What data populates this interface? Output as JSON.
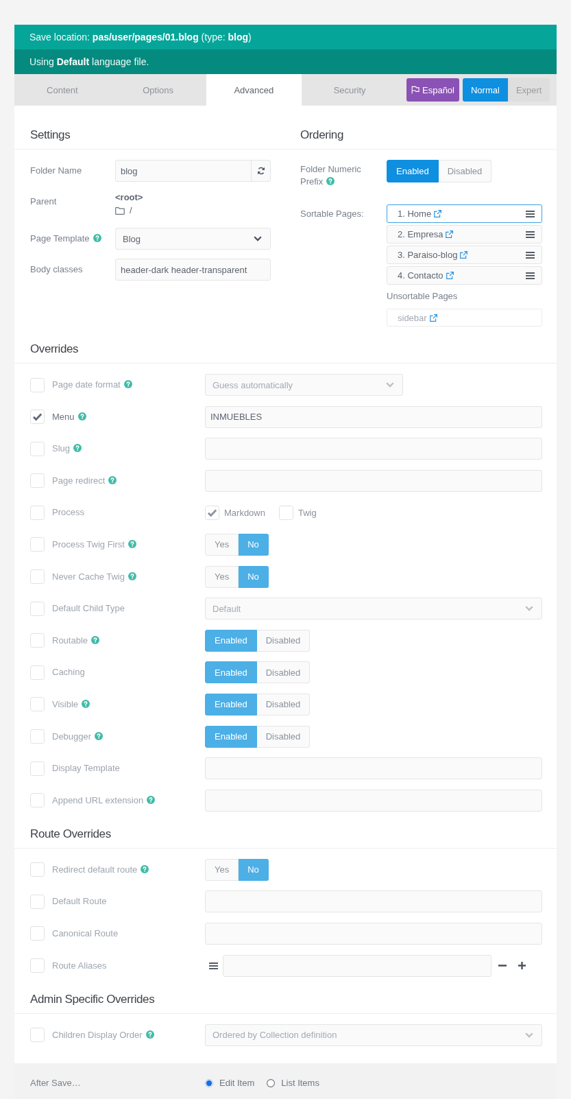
{
  "notices": [
    {
      "kind": "location",
      "text": "Save location: **pas/user/pages/01.blog** (type: **blog**)"
    },
    {
      "kind": "language",
      "text": "Using **Default** language file."
    }
  ],
  "tabs": [
    {
      "label": "Content",
      "selected": false
    },
    {
      "label": "Options",
      "selected": false
    },
    {
      "label": "Advanced",
      "selected": true
    },
    {
      "label": "Security",
      "selected": false
    }
  ],
  "language_button": {
    "label": "Español"
  },
  "mode_switch": [
    {
      "label": "Normal",
      "selected": true
    },
    {
      "label": "Expert",
      "selected": false
    }
  ],
  "settings": {
    "title": "Settings",
    "fields": [
      {
        "kind": "folder",
        "label": "Folder Name",
        "help": false,
        "value": "blog"
      },
      {
        "kind": "parent",
        "label": "Parent",
        "help": false,
        "value": "<root>",
        "path": "/"
      },
      {
        "kind": "select",
        "label": "Page Template",
        "help": true,
        "value": "Blog",
        "disabled": false
      },
      {
        "kind": "text",
        "label": "Body classes",
        "help": false,
        "value": "header-dark header-transparent"
      }
    ]
  },
  "ordering": {
    "title": "Ordering",
    "prefix": {
      "label": "Folder Numeric Prefix",
      "help": true,
      "options": [
        {
          "label": "Enabled",
          "selected": true
        },
        {
          "label": "Disabled",
          "selected": false
        }
      ]
    },
    "sortable": {
      "label": "Sortable Pages:",
      "pages": [
        {
          "label": "1. Home",
          "focused": true
        },
        {
          "label": "2. Empresa",
          "focused": false
        },
        {
          "label": "3. Paraiso-blog",
          "focused": false
        },
        {
          "label": "4. Contacto",
          "focused": false
        }
      ]
    },
    "unsortable": {
      "label": "Unsortable Pages",
      "pages": [
        {
          "label": "sidebar"
        }
      ]
    }
  },
  "sections": [
    {
      "title": "Overrides",
      "rows": [
        {
          "label": "Page date format",
          "help": true,
          "checked": false,
          "kind": "select",
          "value": "Guess automatically",
          "disabled": true
        },
        {
          "label": "Menu",
          "help": true,
          "checked": true,
          "kind": "text",
          "value": "INMUEBLES"
        },
        {
          "label": "Slug",
          "help": true,
          "checked": false,
          "kind": "text"
        },
        {
          "label": "Page redirect",
          "help": true,
          "checked": false,
          "kind": "text"
        },
        {
          "label": "Process",
          "help": false,
          "checked": false,
          "kind": "checkboxes",
          "options": [
            {
              "label": "Markdown",
              "checked": true
            },
            {
              "label": "Twig",
              "checked": false
            }
          ]
        },
        {
          "label": "Process Twig First",
          "help": true,
          "checked": false,
          "kind": "toggle",
          "options": [
            {
              "label": "Yes",
              "selected": false
            },
            {
              "label": "No",
              "selected": true
            }
          ]
        },
        {
          "label": "Never Cache Twig",
          "help": true,
          "checked": false,
          "kind": "toggle",
          "options": [
            {
              "label": "Yes",
              "selected": false
            },
            {
              "label": "No",
              "selected": true
            }
          ]
        },
        {
          "label": "Default Child Type",
          "help": false,
          "checked": false,
          "kind": "select",
          "value": "Default",
          "disabled": true
        },
        {
          "label": "Routable",
          "help": true,
          "checked": false,
          "kind": "toggle",
          "options": [
            {
              "label": "Enabled",
              "selected": true
            },
            {
              "label": "Disabled",
              "selected": false
            }
          ]
        },
        {
          "label": "Caching",
          "help": false,
          "checked": false,
          "kind": "toggle",
          "options": [
            {
              "label": "Enabled",
              "selected": true
            },
            {
              "label": "Disabled",
              "selected": false
            }
          ]
        },
        {
          "label": "Visible",
          "help": true,
          "checked": false,
          "kind": "toggle",
          "options": [
            {
              "label": "Enabled",
              "selected": true
            },
            {
              "label": "Disabled",
              "selected": false
            }
          ]
        },
        {
          "label": "Debugger",
          "help": true,
          "checked": false,
          "kind": "toggle",
          "options": [
            {
              "label": "Enabled",
              "selected": true
            },
            {
              "label": "Disabled",
              "selected": false
            }
          ]
        },
        {
          "label": "Display Template",
          "help": false,
          "checked": false,
          "kind": "text"
        },
        {
          "label": "Append URL extension",
          "help": true,
          "checked": false,
          "kind": "text"
        }
      ]
    },
    {
      "title": "Route Overrides",
      "rows": [
        {
          "label": "Redirect default route",
          "help": true,
          "checked": false,
          "kind": "toggle",
          "options": [
            {
              "label": "Yes",
              "selected": false
            },
            {
              "label": "No",
              "selected": true
            }
          ]
        },
        {
          "label": "Default Route",
          "help": false,
          "checked": false,
          "kind": "text"
        },
        {
          "label": "Canonical Route",
          "help": false,
          "checked": false,
          "kind": "text"
        },
        {
          "label": "Route Aliases",
          "help": false,
          "checked": false,
          "kind": "list"
        }
      ]
    },
    {
      "title": "Admin Specific Overrides",
      "rows": [
        {
          "label": "Children Display Order",
          "help": true,
          "checked": false,
          "kind": "select",
          "value": "Ordered by Collection definition",
          "disabled": true
        }
      ]
    }
  ],
  "after_save": {
    "label": "After Save…",
    "options": [
      {
        "label": "Edit Item",
        "selected": true
      },
      {
        "label": "List Items",
        "selected": false
      }
    ]
  }
}
